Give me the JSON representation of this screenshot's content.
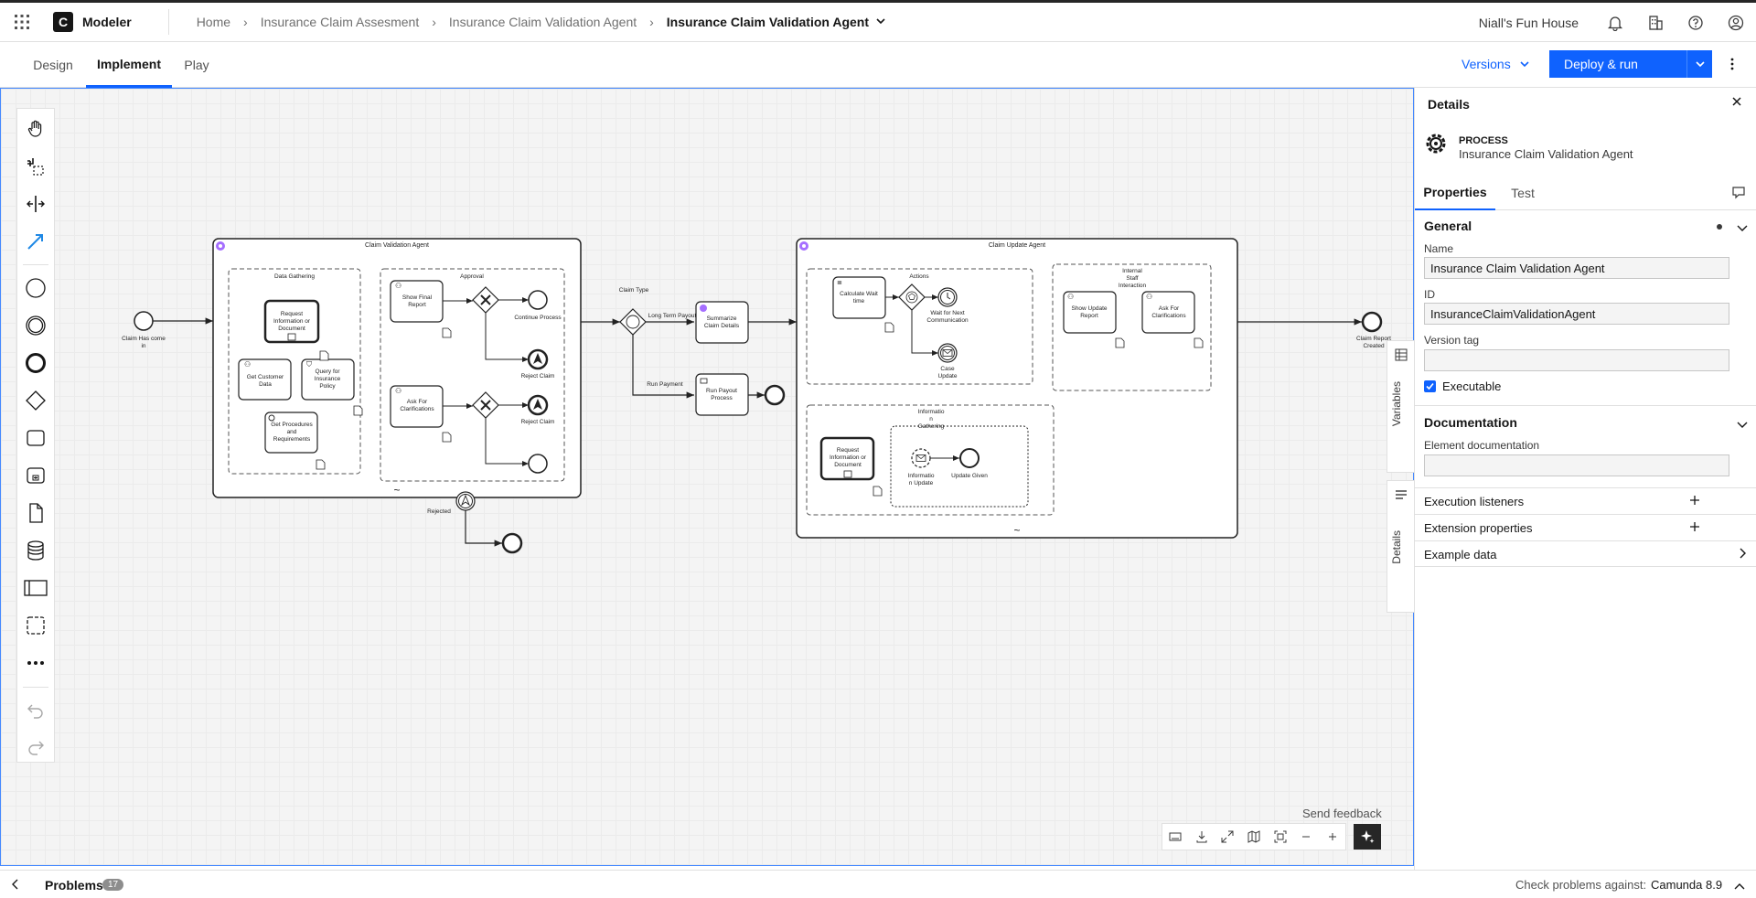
{
  "app": {
    "name": "Modeler",
    "logo_letter": "C"
  },
  "breadcrumbs": [
    "Home",
    "Insurance Claim Assesment",
    "Insurance Claim Validation Agent"
  ],
  "breadcrumb_current": "Insurance Claim Validation Agent",
  "top_right": {
    "org": "Niall's Fun House"
  },
  "mode_tabs": [
    "Design",
    "Implement",
    "Play"
  ],
  "active_mode_tab": "Implement",
  "versions_label": "Versions",
  "deploy_label": "Deploy & run",
  "side_tabs": {
    "variables": "Variables",
    "details": "Details"
  },
  "feedback_label": "Send feedback",
  "bottom": {
    "problems_label": "Problems",
    "problems_count": "17",
    "check_label": "Check problems against:",
    "check_value": "Camunda 8.9"
  },
  "panel": {
    "title": "Details",
    "element_type": "PROCESS",
    "element_name": "Insurance Claim Validation Agent",
    "tabs": [
      "Properties",
      "Test"
    ],
    "general_label": "General",
    "name_label": "Name",
    "name_value": "Insurance Claim Validation Agent",
    "id_label": "ID",
    "id_value": "InsuranceClaimValidationAgent",
    "version_tag_label": "Version tag",
    "version_tag_value": "",
    "executable_label": "Executable",
    "executable_checked": true,
    "documentation_label": "Documentation",
    "element_documentation_label": "Element documentation",
    "element_documentation_value": "",
    "rows": [
      "Execution listeners",
      "Extension properties",
      "Example data"
    ]
  },
  "diagram": {
    "start_label": [
      "Claim Has come",
      "in"
    ],
    "end_label": [
      "Claim Report",
      "Created"
    ],
    "rejected_label": "Rejected",
    "claim_type_label": "Claim Type",
    "long_term_label": "Long Term Payout",
    "run_payment_label": "Run Payment",
    "summarize_task": [
      "Summarize",
      "Claim Details"
    ],
    "payout_task": [
      "Run Payout",
      "Process"
    ],
    "validation_agent": {
      "title": "Claim Validation Agent",
      "data_gathering": "Data Gathering",
      "approval": "Approval",
      "request_info": [
        "Request",
        "Information or",
        "Document"
      ],
      "get_customer": [
        "Get Customer",
        "Data"
      ],
      "query_policy": [
        "Query for",
        "Insurance",
        "Policy"
      ],
      "get_procedures": [
        "Get Procedures",
        "and",
        "Requirements"
      ],
      "show_final": [
        "Show Final",
        "Report"
      ],
      "ask_clarifications": [
        "Ask For",
        "Clarifications"
      ],
      "continue_process": "Continue Process",
      "reject_claim": "Reject Claim"
    },
    "update_agent": {
      "title": "Claim Update Agent",
      "calculate_wait": [
        "Calculate Wait",
        "time"
      ],
      "actions": "Actions",
      "wait_next": [
        "Wait for Next",
        "Communication"
      ],
      "case_update": [
        "Case",
        "Update"
      ],
      "internal_staff": [
        "Internal",
        "Staff",
        "Interaction"
      ],
      "show_update": [
        "Show Update",
        "Report"
      ],
      "ask_clarifications": [
        "Ask For",
        "Clarifications"
      ],
      "info_gathering": [
        "Informatio",
        "n",
        "Gathering"
      ],
      "request_info": [
        "Request",
        "Information or",
        "Document"
      ],
      "info_update": [
        "Informatio",
        "n Update"
      ],
      "update_given": "Update Given"
    }
  },
  "colors": {
    "accent": "#0f62fe",
    "ai_marker": "#a56eff",
    "canvas_bg": "#f4f4f4"
  }
}
